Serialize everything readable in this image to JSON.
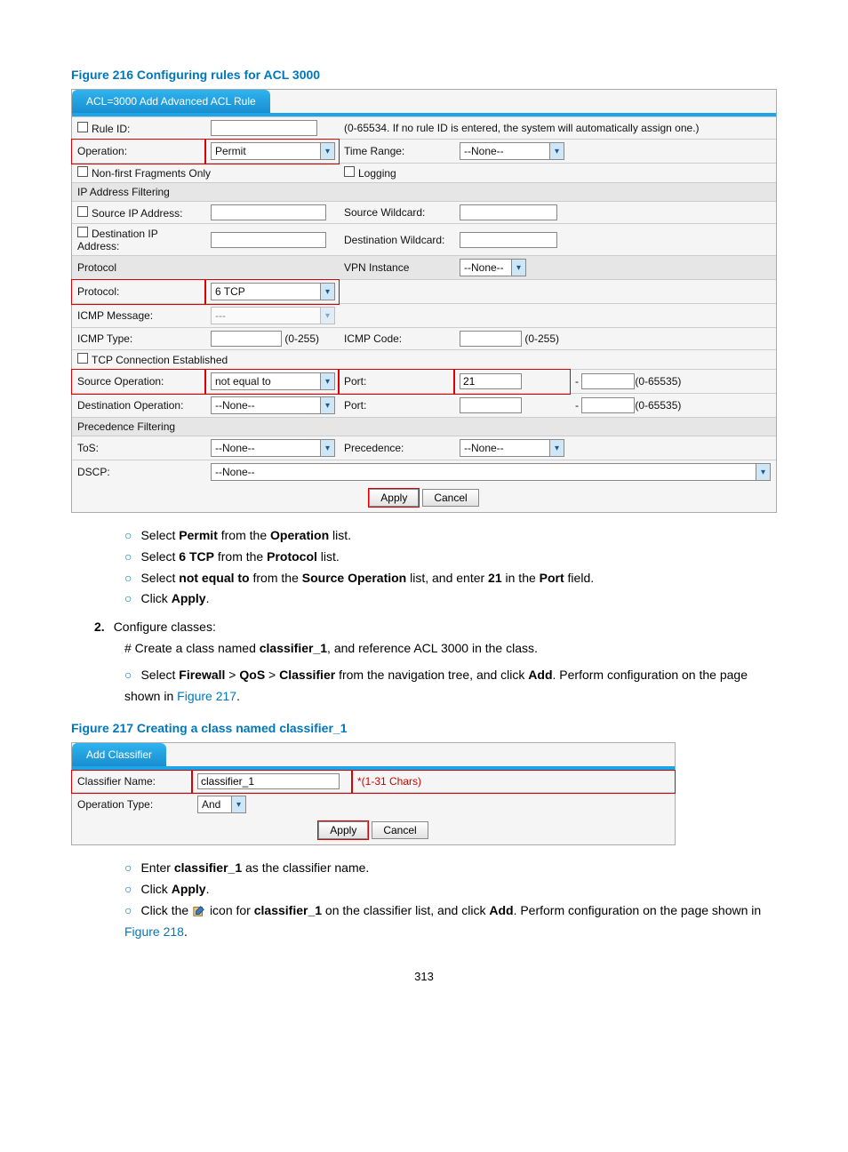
{
  "page_number": "313",
  "fig216": {
    "title": "Figure 216 Configuring rules for ACL 3000",
    "tab": "ACL=3000 Add Advanced ACL Rule",
    "rule_id_label": "Rule ID:",
    "rule_id_hint": "(0-65534. If no rule ID is entered, the system will automatically assign one.)",
    "operation_label": "Operation:",
    "operation_value": "Permit",
    "time_range_label": "Time Range:",
    "time_range_value": "--None--",
    "nonfirst_label": "Non-first Fragments Only",
    "logging_label": "Logging",
    "section_ip": "IP Address Filtering",
    "src_ip_label": "Source IP Address:",
    "src_wc_label": "Source Wildcard:",
    "dst_ip_label": "Destination IP Address:",
    "dst_wc_label": "Destination Wildcard:",
    "section_proto": "Protocol",
    "vpn_label": "VPN Instance",
    "vpn_value": "--None--",
    "protocol_label": "Protocol:",
    "protocol_value": "6 TCP",
    "icmp_msg_label": "ICMP Message:",
    "icmp_msg_value": "---",
    "icmp_type_label": "ICMP Type:",
    "icmp_type_hint": "(0-255)",
    "icmp_code_label": "ICMP Code:",
    "icmp_code_hint": "(0-255)",
    "tcp_est_label": "TCP Connection Established",
    "src_op_label": "Source Operation:",
    "src_op_value": "not equal to",
    "port_label": "Port:",
    "port_value": "21",
    "port_hint": "(0-65535)",
    "dst_op_label": "Destination Operation:",
    "dst_op_value": "--None--",
    "section_prec": "Precedence Filtering",
    "tos_label": "ToS:",
    "tos_value": "--None--",
    "prec_label": "Precedence:",
    "prec_value": "--None--",
    "dscp_label": "DSCP:",
    "dscp_value": "--None--",
    "apply": "Apply",
    "cancel": "Cancel"
  },
  "instr1": {
    "i1": "Select ",
    "i1b1": "Permit",
    "i1m": " from the ",
    "i1b2": "Operation",
    "i1e": " list.",
    "i2": "Select ",
    "i2b1": "6 TCP",
    "i2m": " from the ",
    "i2b2": "Protocol",
    "i2e": " list.",
    "i3": "Select ",
    "i3b1": "not equal to",
    "i3m": " from the ",
    "i3b2": "Source Operation",
    "i3m2": " list, and enter ",
    "i3b3": "21",
    "i3m3": " in the ",
    "i3b4": "Port",
    "i3e": " field.",
    "i4": "Click ",
    "i4b": "Apply",
    "i4e": "."
  },
  "step2": {
    "num": "2.",
    "text": "Configure classes:",
    "create_pre": "# Create a class named ",
    "create_b": "classifier_1",
    "create_post": ", and reference ACL 3000 in the class.",
    "nav1": "Select ",
    "nav_fw": "Firewall",
    "nav_gt1": " > ",
    "nav_qos": "QoS",
    "nav_gt2": " > ",
    "nav_cls": "Classifier",
    "nav_post": " from the navigation tree, and click ",
    "nav_add": "Add",
    "nav_end": ". Perform configuration on the page shown in ",
    "nav_link": "Figure 217",
    "nav_dot": "."
  },
  "fig217": {
    "title": "Figure 217 Creating a class named classifier_1",
    "tab": "Add Classifier",
    "cls_name_label": "Classifier Name:",
    "cls_name_value": "classifier_1",
    "cls_name_hint": "*(1-31 Chars)",
    "op_type_label": "Operation Type:",
    "op_type_value": "And",
    "apply": "Apply",
    "cancel": "Cancel"
  },
  "instr2": {
    "i1": "Enter ",
    "i1b": "classifier_1",
    "i1e": " as the classifier name.",
    "i2": "Click ",
    "i2b": "Apply",
    "i2e": ".",
    "i3a": "Click the ",
    "i3b": " icon for ",
    "i3c": "classifier_1",
    "i3d": " on the classifier list, and click ",
    "i3e": "Add",
    "i3f": ". Perform configuration on the page shown in ",
    "i3link": "Figure 218",
    "i3dot": "."
  }
}
